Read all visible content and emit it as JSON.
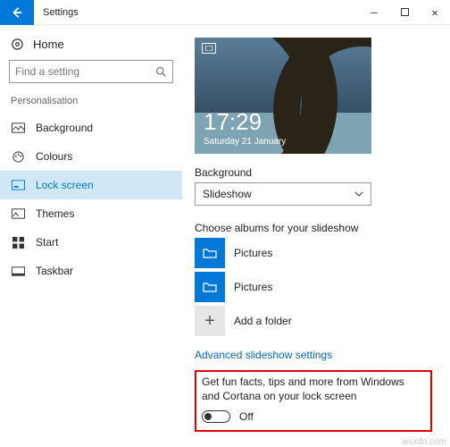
{
  "titlebar": {
    "title": "Settings"
  },
  "sidebar": {
    "home": "Home",
    "search_placeholder": "Find a setting",
    "group": "Personalisation",
    "items": [
      {
        "label": "Background"
      },
      {
        "label": "Colours"
      },
      {
        "label": "Lock screen"
      },
      {
        "label": "Themes"
      },
      {
        "label": "Start"
      },
      {
        "label": "Taskbar"
      }
    ]
  },
  "preview": {
    "time": "17:29",
    "date": "Saturday 21 January"
  },
  "background": {
    "label": "Background",
    "value": "Slideshow"
  },
  "albums": {
    "label": "Choose albums for your slideshow",
    "items": [
      {
        "label": "Pictures"
      },
      {
        "label": "Pictures"
      }
    ],
    "add": "Add a folder"
  },
  "advanced_link": "Advanced slideshow settings",
  "funfacts": {
    "label": "Get fun facts, tips and more from Windows and Cortana on your lock screen",
    "value": "Off"
  },
  "watermark": "wsxdn.com"
}
